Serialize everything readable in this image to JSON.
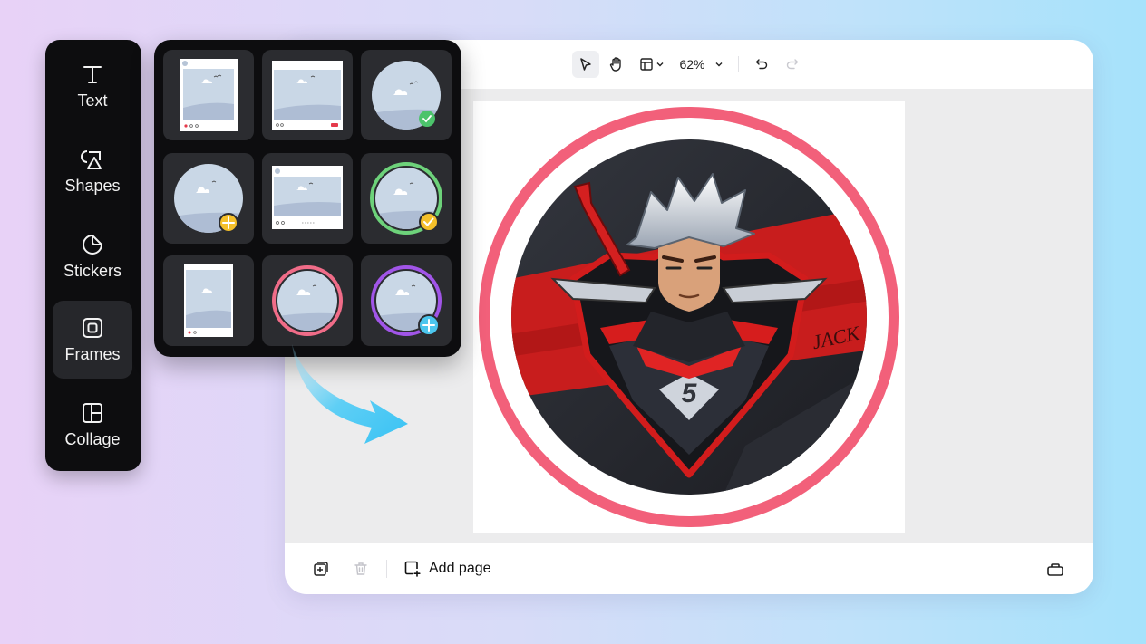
{
  "sidebar": {
    "items": [
      {
        "label": "Text",
        "icon": "text-icon"
      },
      {
        "label": "Shapes",
        "icon": "shapes-icon"
      },
      {
        "label": "Stickers",
        "icon": "sticker-icon"
      },
      {
        "label": "Frames",
        "icon": "frame-icon",
        "active": true
      },
      {
        "label": "Collage",
        "icon": "collage-icon"
      }
    ]
  },
  "toolbar": {
    "zoom": "62%",
    "tools": [
      "pointer-icon",
      "hand-icon",
      "layout-icon",
      "undo-icon",
      "redo-icon"
    ]
  },
  "canvas": {
    "logo_text": "JACK",
    "logo_emblem": "5",
    "frame_color": "#f2607a"
  },
  "bottombar": {
    "add_page_label": "Add page",
    "icons": [
      "duplicate-page-icon",
      "delete-page-icon",
      "add-page-icon",
      "pages-panel-icon"
    ]
  },
  "frames_panel": {
    "tiles": [
      {
        "kind": "social-post",
        "badge": null
      },
      {
        "kind": "video-post",
        "badge": null
      },
      {
        "kind": "circle",
        "badge": "verified-green"
      },
      {
        "kind": "circle",
        "badge": "plus-yellow"
      },
      {
        "kind": "feed-post",
        "badge": null
      },
      {
        "kind": "circle-ring",
        "ring": "#6dd27a",
        "badge": "check-yellow"
      },
      {
        "kind": "story",
        "badge": null
      },
      {
        "kind": "circle-ring",
        "ring": "#f06c88",
        "badge": null
      },
      {
        "kind": "circle-ring",
        "ring": "#a155e8",
        "badge": "plus-blue"
      }
    ]
  },
  "colors": {
    "accent_arrow": "#3cc4f5",
    "panel_bg": "#0d0d0f"
  }
}
